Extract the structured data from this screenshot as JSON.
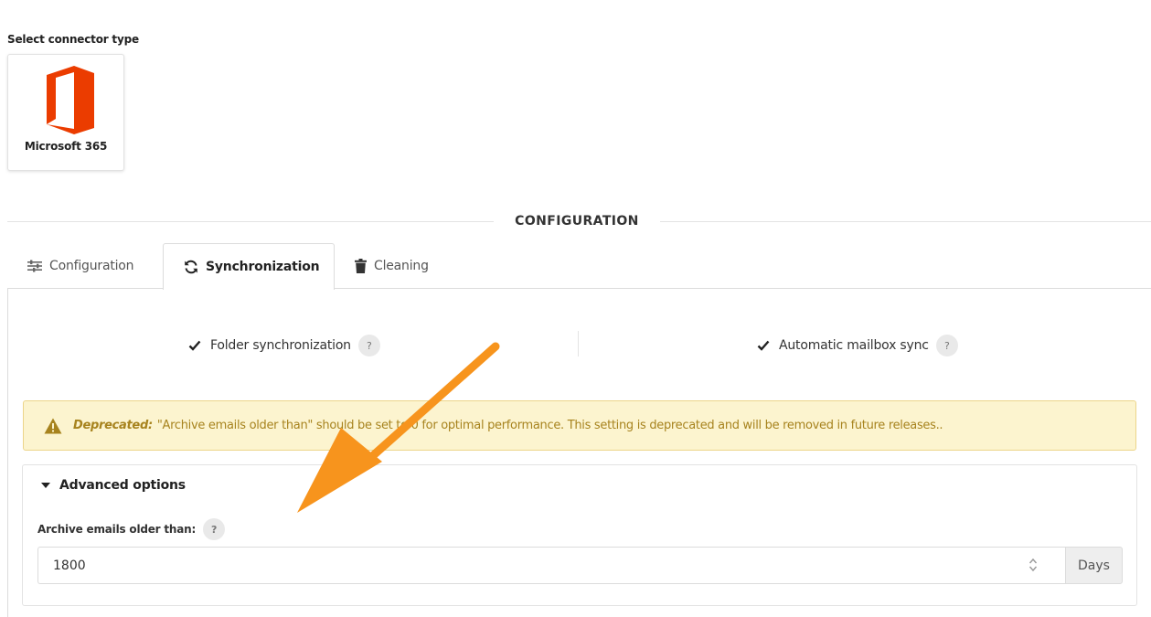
{
  "connector": {
    "select_label": "Select connector type",
    "name": "Microsoft 365",
    "icon": "office-icon",
    "brand_color": "#eb3c00"
  },
  "section_title": "CONFIGURATION",
  "tabs": [
    {
      "label": "Configuration",
      "icon": "sliders-icon",
      "active": false
    },
    {
      "label": "Synchronization",
      "icon": "sync-icon",
      "active": true
    },
    {
      "label": "Cleaning",
      "icon": "trash-icon",
      "active": false
    }
  ],
  "options": {
    "folder_sync": {
      "label": "Folder synchronization",
      "checked": true,
      "help": "?"
    },
    "auto_mailbox_sync": {
      "label": "Automatic mailbox sync",
      "checked": true,
      "help": "?"
    }
  },
  "warning": {
    "label": "Deprecated:",
    "text": "\"Archive emails older than\" should be set to 0 for optimal performance. This setting is deprecated and will be removed in future releases..",
    "icon": "warning-icon",
    "color": "#a7831e",
    "background": "#fcf4cf"
  },
  "advanced": {
    "title": "Advanced options",
    "field_label": "Archive emails older than:",
    "help": "?",
    "value": "1800",
    "unit": "Days"
  },
  "annotation": {
    "color": "#f7941d",
    "icon": "arrow-annotation"
  }
}
